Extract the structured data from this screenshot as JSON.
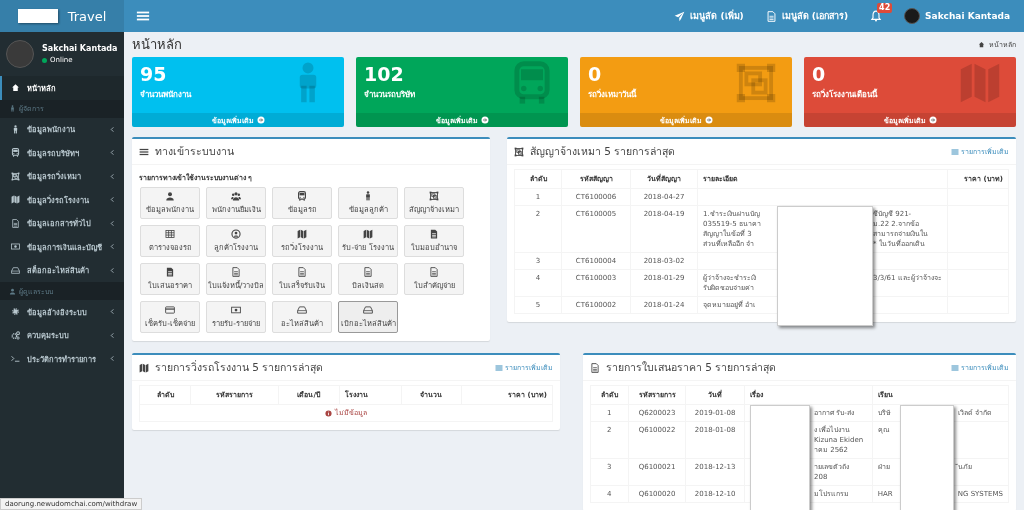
{
  "topbar": {
    "brand": "Travel",
    "links": [
      {
        "label": "เมนูลัด (เพิ่ม)"
      },
      {
        "label": "เมนูลัด (เอกสาร)"
      }
    ],
    "notifications": "42",
    "user": "Sakchai Kantada"
  },
  "sidebar": {
    "user": {
      "name": "Sakchai Kantada",
      "status": "Online"
    },
    "items": [
      {
        "kind": "link",
        "label": "หน้าหลัก",
        "selected": true,
        "has_submenu": false
      },
      {
        "kind": "header",
        "label": "ผู้จัดการ"
      },
      {
        "kind": "link",
        "label": "ข้อมูลพนักงาน",
        "selected": false,
        "has_submenu": true
      },
      {
        "kind": "link",
        "label": "ข้อมูลรถบริษัทฯ",
        "selected": false,
        "has_submenu": true
      },
      {
        "kind": "link",
        "label": "ข้อมูลรถวิ่งเหมา",
        "selected": false,
        "has_submenu": true
      },
      {
        "kind": "link",
        "label": "ข้อมูลวิ่งรถโรงงาน",
        "selected": false,
        "has_submenu": true
      },
      {
        "kind": "link",
        "label": "ข้อมูลเอกสารทั่วไป",
        "selected": false,
        "has_submenu": true
      },
      {
        "kind": "link",
        "label": "ข้อมูลการเงินและบัญชี",
        "selected": false,
        "has_submenu": true
      },
      {
        "kind": "link",
        "label": "สต็อกอะไหล่สินค้า",
        "selected": false,
        "has_submenu": true
      },
      {
        "kind": "header",
        "label": "ผู้ดูแลระบบ"
      },
      {
        "kind": "link",
        "label": "ข้อมูลอ้างอิงระบบ",
        "selected": false,
        "has_submenu": true
      },
      {
        "kind": "link",
        "label": "ควบคุมระบบ",
        "selected": false,
        "has_submenu": true
      },
      {
        "kind": "link",
        "label": "ประวัติการทำรายการ",
        "selected": false,
        "has_submenu": true
      }
    ]
  },
  "page": {
    "title": "หน้าหลัก",
    "breadcrumb": "หน้าหลัก"
  },
  "cards": [
    {
      "value": "95",
      "label": "จำนวนพนักงาน",
      "link": "ข้อมูลเพิ่มเติม",
      "color": "#00c0ef"
    },
    {
      "value": "102",
      "label": "จำนวนรถบริษัท",
      "link": "ข้อมูลเพิ่มเติม",
      "color": "#00a65a"
    },
    {
      "value": "0",
      "label": "รถวิ่งเหมาวันนี้",
      "link": "ข้อมูลเพิ่มเติม",
      "color": "#f39c12"
    },
    {
      "value": "0",
      "label": "รถวิ่งโรงงานเดือนนี้",
      "link": "ข้อมูลเพิ่มเติม",
      "color": "#dd4b39"
    }
  ],
  "shortcuts": {
    "title": "ทางเข้าระบบงาน",
    "subtitle": "รายการทางเข้าใช้งานระบบงานต่าง ๆ",
    "tiles": [
      {
        "label": "ข้อมูลพนักงาน",
        "selected": false
      },
      {
        "label": "พนักงานยืมเงิน",
        "selected": false
      },
      {
        "label": "ข้อมูลรถ",
        "selected": false
      },
      {
        "label": "ข้อมูลลูกค้า",
        "selected": false
      },
      {
        "label": "สัญญาจ้างเหมา",
        "selected": false
      },
      {
        "label": "ตารางจองรถ",
        "selected": false
      },
      {
        "label": "ลูกค้าโรงงาน",
        "selected": false
      },
      {
        "label": "รถวิ่งโรงงาน",
        "selected": false
      },
      {
        "label": "รับ-จ่าย โรงงาน",
        "selected": false
      },
      {
        "label": "ใบมอบอำนาจ",
        "selected": false
      },
      {
        "label": "ใบเสนอราคา",
        "selected": false
      },
      {
        "label": "ใบแจ้งหนี้/วางบิล",
        "selected": false
      },
      {
        "label": "ใบเสร็จรับเงิน",
        "selected": false
      },
      {
        "label": "บิลเงินสด",
        "selected": false
      },
      {
        "label": "ใบสำคัญจ่าย",
        "selected": false
      },
      {
        "label": "เช็ครับ-เช็คจ่าย",
        "selected": false
      },
      {
        "label": "รายรับ-รายจ่าย",
        "selected": false
      },
      {
        "label": "อะไหล่สินค้า",
        "selected": false
      },
      {
        "label": "เบิกอะไหล่สินค้า",
        "selected": true
      }
    ]
  },
  "contracts": {
    "title": "สัญญาจ้างเหมา 5 รายการล่าสุด",
    "more": "รายการเพิ่มเติม",
    "columns": [
      "ลำดับ",
      "รหัสสัญญา",
      "วันที่สัญญา",
      "รายละเอียด",
      "ราคา (บาท)"
    ],
    "rows": [
      {
        "no": "1",
        "code": "CT6100006",
        "date": "2018-04-27",
        "detail_left": "",
        "detail_right": ""
      },
      {
        "no": "2",
        "code": "CT6100005",
        "date": "2018-04-19",
        "detail_left": "1.ชำระเงินผ่านบัญ\n035519-5 ธนาคา\nสัญญาในข้อที่ 3\nส่วนที่เหลืออีก จำ",
        "detail_right": "ชีบัญชี 921-\nม.22 2.จากข้อ\nสามารถจ่ายเงินใน\n* ในวันที่ออกเดิน"
      },
      {
        "no": "3",
        "code": "CT6100004",
        "date": "2018-03-02",
        "detail_left": "",
        "detail_right": ""
      },
      {
        "no": "4",
        "code": "CT6100003",
        "date": "2018-01-29",
        "detail_left": "ผู้ว่าจ้างจะชำระเงิ\nรับผิดชอบจ่ายค่า",
        "detail_right": "3/3/61 และผู้ว่าจ้างจะ"
      },
      {
        "no": "5",
        "code": "CT6100002",
        "date": "2018-01-24",
        "detail_left": "จุดหมายอยู่ที่ อำเ",
        "detail_right": ""
      }
    ]
  },
  "factory_runs": {
    "title": "รายการวิ่งรถโรงงาน 5 รายการล่าสุด",
    "more": "รายการเพิ่มเติม",
    "columns": [
      "ลำดับ",
      "รหัสรายการ",
      "เดือน/ปี",
      "โรงงาน",
      "จำนวน",
      "ราคา (บาท)"
    ],
    "empty": "ไม่มีข้อมูล"
  },
  "quotes": {
    "title": "รายการใบเสนอราคา 5 รายการล่าสุด",
    "more": "รายการเพิ่มเติม",
    "columns": [
      "ลำดับ",
      "รหัสรายการ",
      "วันที่",
      "เรื่อง",
      "เรียน"
    ],
    "rows": [
      {
        "no": "1",
        "code": "Q6200023",
        "date": "2019-01-08",
        "subject": "อากาศ รับ-ส่ง",
        "to_left": "บริษั",
        "to_right": "เวิลด์ จำกัด"
      },
      {
        "no": "2",
        "code": "Q6100022",
        "date": "2018-01-08",
        "subject": "ง เพื่อไปงาน\nKizuna Ekiden\nาคม 2562",
        "to_left": "คุณ",
        "to_right": ""
      },
      {
        "no": "3",
        "code": "Q6100021",
        "date": "2018-12-13",
        "subject": "ายเลขตัวถัง\n208",
        "to_left": "ฝ่าย",
        "to_right": "ันภัย"
      },
      {
        "no": "4",
        "code": "Q6100020",
        "date": "2018-12-10",
        "subject": "มโปรแกรม",
        "to_left": "HAR",
        "to_right": "NG SYSTEMS"
      }
    ]
  },
  "status_url": "daorung.newudomchai.com/withdraw"
}
